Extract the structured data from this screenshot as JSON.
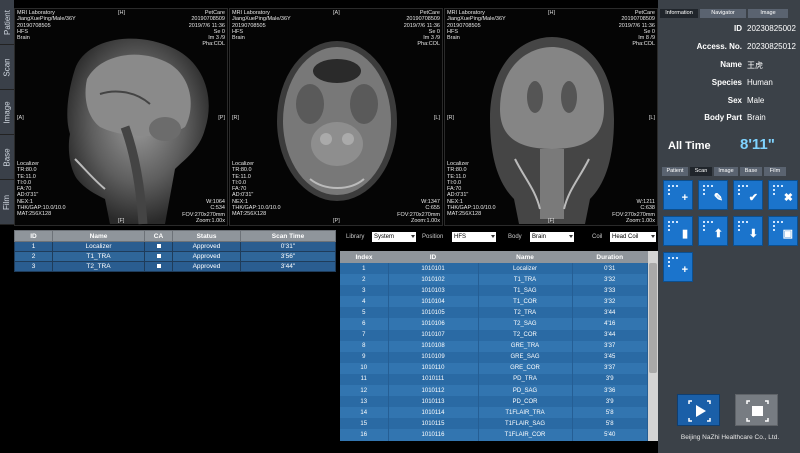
{
  "left_nav": [
    "Patient",
    "Scan",
    "Image",
    "Base",
    "Film"
  ],
  "viewports": [
    {
      "tl": [
        "MRI Laboratory",
        "JiangXuePing/Male/36Y",
        "20190708505"
      ],
      "tl2": [
        "HFS",
        "Brain"
      ],
      "tr": [
        "PetCare",
        "20190708509",
        "2019/7/6 11:36",
        "Se 0",
        "Im 3 /9",
        "Pha:COL"
      ],
      "bl": [
        "Localizer",
        "TR:80.0",
        "TE:11.0",
        "TI:0.0",
        "FA:70",
        "AD:0'31\"",
        "NEX:1",
        "THK/GAP:10.0/10.0",
        "MAT:256X128"
      ],
      "br": [
        "W:1064",
        "C:534",
        "FOV:270x270mm",
        "Zoom:1.00x"
      ],
      "top": "[H]",
      "bottom": "[F]",
      "left": "[A]",
      "right": "[P]"
    },
    {
      "tl": [
        "MRI Laboratory",
        "JiangXuePing/Male/36Y",
        "20190708505"
      ],
      "tl2": [
        "HFS",
        "Brain"
      ],
      "tr": [
        "PetCare",
        "20190708509",
        "2019/7/6 11:36",
        "Se 0",
        "Im 3 /9",
        "Pha:COL"
      ],
      "bl": [
        "Localizer",
        "TR:80.0",
        "TE:11.0",
        "TI:0.0",
        "FA:70",
        "AD:0'31\"",
        "NEX:1",
        "THK/GAP:10.0/10.0",
        "MAT:256X128"
      ],
      "br": [
        "W:1347",
        "C:655",
        "FOV:270x270mm",
        "Zoom:1.00x"
      ],
      "top": "[A]",
      "bottom": "[P]",
      "left": "[R]",
      "right": "[L]"
    },
    {
      "tl": [
        "MRI Laboratory",
        "JiangXuePing/Male/36Y",
        "20190708505"
      ],
      "tl2": [
        "HFS",
        "Brain"
      ],
      "tr": [
        "PetCare",
        "20190708509",
        "2019/7/6 11:36",
        "Se 0",
        "Im 8 /9",
        "Pha:COL"
      ],
      "bl": [
        "Localizer",
        "TR:80.0",
        "TE:11.0",
        "TI:0.0",
        "FA:70",
        "AD:0'31\"",
        "NEX:1",
        "THK/GAP:10.0/10.0",
        "MAT:256X128"
      ],
      "br": [
        "W:1211",
        "C:638",
        "FOV:270x270mm",
        "Zoom:1.00x"
      ],
      "top": "[H]",
      "bottom": "[F]",
      "left": "[R]",
      "right": "[L]"
    }
  ],
  "protocol_table": {
    "headers": [
      "ID",
      "Name",
      "CA",
      "Status",
      "Scan Time"
    ],
    "rows": [
      {
        "id": "1",
        "name": "Localizer",
        "status": "Approved",
        "time": "0'31\""
      },
      {
        "id": "2",
        "name": "T1_TRA",
        "status": "Approved",
        "time": "3'56\""
      },
      {
        "id": "3",
        "name": "T2_TRA",
        "status": "Approved",
        "time": "3'44\""
      }
    ]
  },
  "filters": {
    "library_label": "Library",
    "library_value": "System",
    "position_label": "Position",
    "position_value": "HFS",
    "body_label": "Body",
    "body_value": "Brain",
    "coil_label": "Coil",
    "coil_value": "Head Coil"
  },
  "sequence_table": {
    "headers": [
      "Index",
      "ID",
      "Name",
      "Duration"
    ],
    "rows": [
      [
        "1",
        "1010101",
        "Localizer",
        "0'31"
      ],
      [
        "2",
        "1010102",
        "T1_TRA",
        "3'32"
      ],
      [
        "3",
        "1010103",
        "T1_SAG",
        "3'33"
      ],
      [
        "4",
        "1010104",
        "T1_COR",
        "3'32"
      ],
      [
        "5",
        "1010105",
        "T2_TRA",
        "3'44"
      ],
      [
        "6",
        "1010106",
        "T2_SAG",
        "4'16"
      ],
      [
        "7",
        "1010107",
        "T2_COR",
        "3'44"
      ],
      [
        "8",
        "1010108",
        "GRE_TRA",
        "3'37"
      ],
      [
        "9",
        "1010109",
        "GRE_SAG",
        "3'45"
      ],
      [
        "10",
        "1010110",
        "GRE_COR",
        "3'37"
      ],
      [
        "11",
        "1010111",
        "PD_TRA",
        "3'9"
      ],
      [
        "12",
        "1010112",
        "PD_SAG",
        "3'36"
      ],
      [
        "13",
        "1010113",
        "PD_COR",
        "3'9"
      ],
      [
        "14",
        "1010114",
        "T1FLAIR_TRA",
        "5'8"
      ],
      [
        "15",
        "1010115",
        "T1FLAIR_SAG",
        "5'8"
      ],
      [
        "16",
        "1010116",
        "T1FLAIR_COR",
        "5'40"
      ]
    ]
  },
  "right_tabs": [
    "Information",
    "Navigator",
    "Image"
  ],
  "info": {
    "id_label": "ID",
    "id": "20230825002",
    "access_label": "Access. No.",
    "access": "20230825012",
    "name_label": "Name",
    "name": "王虎",
    "species_label": "Species",
    "species": "Human",
    "sex_label": "Sex",
    "sex": "Male",
    "body_label": "Body Part",
    "body": "Brain",
    "alltime_label": "All Time",
    "alltime": "8'11\""
  },
  "bottom_tabs": [
    "Patient",
    "Scan",
    "Image",
    "Base",
    "Film"
  ],
  "tool_buttons": [
    "add-sequence",
    "edit-sequence",
    "confirm-sequence",
    "delete-sequence",
    "trash",
    "move-up",
    "move-down",
    "save",
    "insert"
  ],
  "company": "Beijing NaZhi Healthcare Co., Ltd.",
  "colors": {
    "accent": "#1b74cc",
    "table_row": "#2a6aa4",
    "panel": "#3b4148",
    "header": "#8f959b",
    "time": "#7fd3ff"
  }
}
